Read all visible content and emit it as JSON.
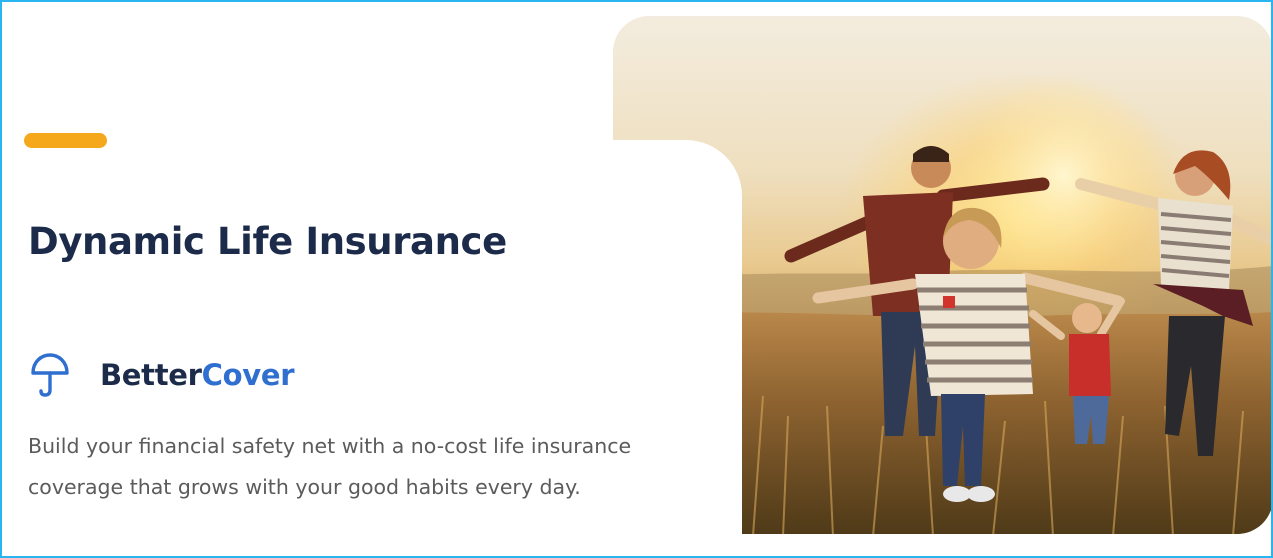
{
  "hero": {
    "title": "Dynamic Life Insurance",
    "brand_part1": "Better",
    "brand_part2": "Cover",
    "description": "Build your financial safety net with a no-cost life insurance coverage that grows with your good habits every day."
  },
  "colors": {
    "accent": "#f5a81b",
    "title": "#1c2b4a",
    "brand_blue": "#2f6fcf",
    "frame_border": "#29b6f0"
  },
  "icons": {
    "brand_logo": "umbrella-icon"
  }
}
